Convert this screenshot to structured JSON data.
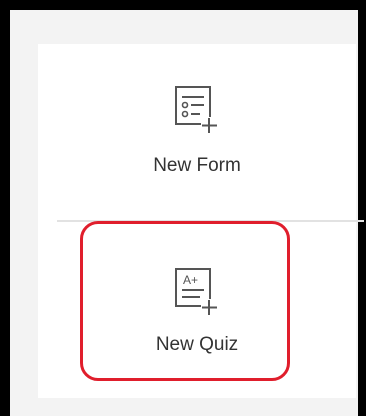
{
  "options": {
    "new_form": {
      "label": "New Form",
      "icon": "form-add-icon"
    },
    "new_quiz": {
      "label": "New Quiz",
      "icon": "quiz-add-icon",
      "icon_text": "A+"
    }
  },
  "colors": {
    "highlight": "#e01e2c",
    "frame": "#000000",
    "panel": "#ffffff",
    "text": "#333333",
    "icon": "#555555"
  }
}
